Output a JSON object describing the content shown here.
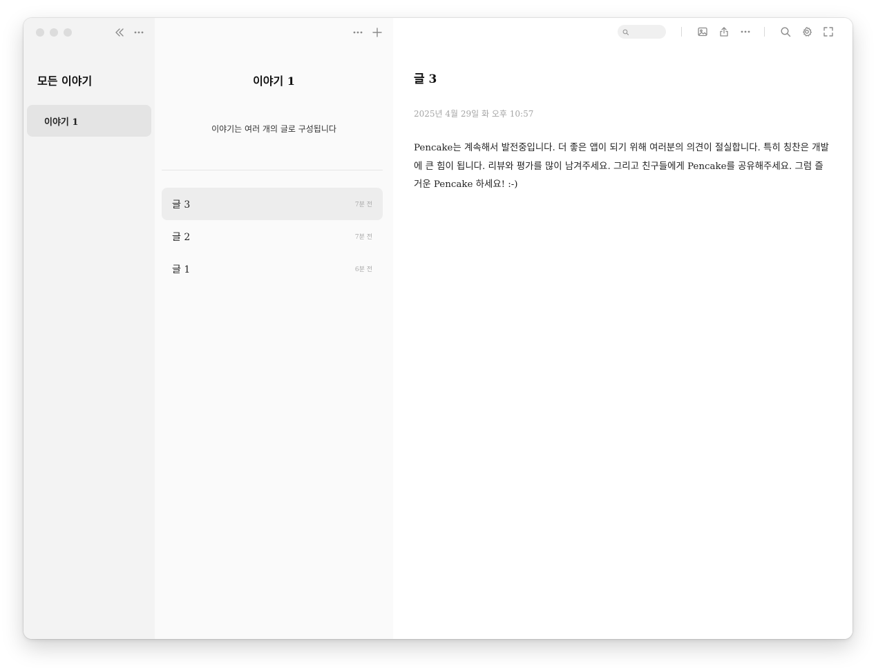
{
  "sidebar": {
    "title": "모든 이야기",
    "items": [
      {
        "label": "이야기 1",
        "selected": true
      }
    ]
  },
  "story": {
    "title": "이야기 1",
    "description": "이야기는 여러 개의 글로 구성됩니다",
    "posts": [
      {
        "title": "글 3",
        "time": "7분 전",
        "selected": true
      },
      {
        "title": "글 2",
        "time": "7분 전",
        "selected": false
      },
      {
        "title": "글 1",
        "time": "6분 전",
        "selected": false
      }
    ]
  },
  "editor": {
    "search_placeholder": "",
    "title": "글 3",
    "date": "2025년 4월 29일 화 오후 10:57",
    "body": "Pencake는 계속해서 발전중입니다. 더 좋은 앱이 되기 위해 여러분의 의견이 절실합니다. 특히 칭찬은 개발에 큰 힘이 됩니다. 리뷰와 평가를 많이 남겨주세요. 그리고 친구들에게 Pencake를 공유해주세요. 그럼 즐거운 Pencake 하세요!  :-)"
  },
  "icons": {
    "collapse": "chevrons-left-icon",
    "more": "ellipsis-icon",
    "add": "plus-icon",
    "image": "image-icon",
    "share": "share-icon",
    "search": "search-icon",
    "settings": "gear-icon",
    "fullscreen": "fullscreen-icon"
  },
  "colors": {
    "sidebar_bg": "#f3f3f3",
    "list_bg": "#fafafa",
    "selected_bg": "#e4e4e4",
    "muted_text": "#a5a5a5"
  }
}
